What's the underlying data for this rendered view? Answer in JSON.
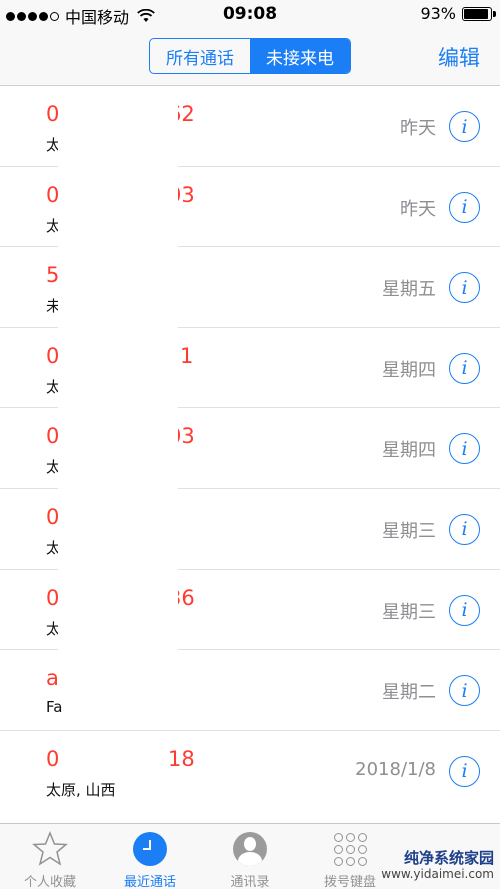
{
  "status_bar": {
    "carrier": "中国移动",
    "time": "09:08",
    "battery_text": "93%",
    "battery_level": 0.93
  },
  "nav": {
    "segments": [
      "所有通话",
      "未接来电"
    ],
    "active_segment": 1,
    "edit_label": "编辑"
  },
  "calls": [
    {
      "number": "0",
      "number_tail": "62",
      "location": "太",
      "time": "昨天"
    },
    {
      "number": "0",
      "number_tail": "03",
      "location": "太",
      "time": "昨天"
    },
    {
      "number": "5",
      "number_tail": "",
      "location": "未",
      "time": "星期五"
    },
    {
      "number": "0",
      "number_tail": "1",
      "location": "太",
      "time": "星期四"
    },
    {
      "number": "0",
      "number_tail": "03",
      "location": "太",
      "time": "星期四"
    },
    {
      "number": "0",
      "number_tail": "",
      "location": "太",
      "time": "星期三"
    },
    {
      "number": "0",
      "number_tail": "36",
      "location": "太",
      "time": "星期三"
    },
    {
      "number": "a",
      "number_tail": "",
      "location": "Fa",
      "time": "星期二"
    },
    {
      "number": "0",
      "number_tail": "18",
      "location": "太原, 山西",
      "time": "2018/1/8"
    }
  ],
  "info_glyph": "i",
  "tabs": [
    {
      "label": "个人收藏",
      "icon": "star-icon"
    },
    {
      "label": "最近通话",
      "icon": "clock-icon"
    },
    {
      "label": "通讯录",
      "icon": "contact-icon"
    },
    {
      "label": "拨号键盘",
      "icon": "keypad-icon"
    }
  ],
  "active_tab": 1,
  "watermark": {
    "title": "纯净系统家园",
    "url": "www.yidaimei.com"
  },
  "colors": {
    "accent": "#1b7ef5",
    "missed": "#ff3b30",
    "secondary": "#8e8e93"
  }
}
